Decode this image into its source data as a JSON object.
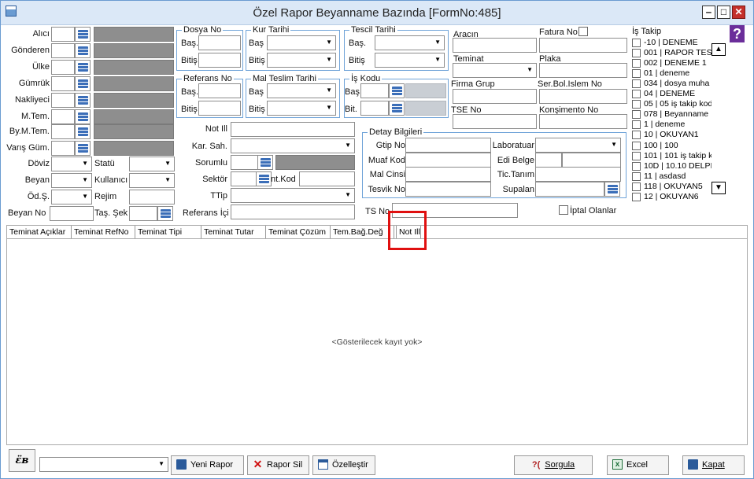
{
  "window": {
    "title": "Özel Rapor Beyanname Bazında [FormNo:485]",
    "help": "?"
  },
  "left": {
    "alici": "Alıcı",
    "gonderen": "Gönderen",
    "ulke": "Ülke",
    "gumruk": "Gümrük",
    "nakliyeci": "Nakliyeci",
    "mtem": "M.Tem.",
    "bymtem": "By.M.Tem.",
    "varis": "Varış Güm.",
    "doviz": "Döviz",
    "beyan": "Beyan",
    "ods": "Öd.Ş.",
    "beyanno": "Beyan No",
    "statu": "Statü",
    "kullanici": "Kullanıcı",
    "rejim": "Rejim",
    "tassek": "Taş. Şek"
  },
  "groups": {
    "dosya_no": "Dosya No",
    "kur_tarihi": "Kur Tarihi",
    "tescil_tarihi": "Tescil Tarihi",
    "referans_no": "Referans No",
    "mal_teslim": "Mal Teslim Tarihi",
    "is_kodu": "İş Kodu",
    "bas": "Baş.",
    "bitis": "Bitiş",
    "bit": "Bit.",
    "bas2": "Baş",
    "bitis2": "Bitiş"
  },
  "mid": {
    "not_ill": "Not Ill",
    "kar_sah": "Kar. Sah.",
    "sorumlu": "Sorumlu",
    "sektor": "Sektör",
    "int_kod": "nt.Kod",
    "ttip": "TTip",
    "referans_ici": "Referans İçi"
  },
  "right": {
    "aracin": "Aracın",
    "fatura_no": "Fatura No",
    "teminat": "Teminat",
    "plaka": "Plaka",
    "firma_grup": "Firma Grup",
    "ser_bol": "Ser.Bol.Islem No",
    "tse_no": "TSE No",
    "konsimento": "Konşimento No",
    "ts_no": "TS No",
    "iptal": "İptal Olanlar"
  },
  "detay": {
    "title": "Detay Bilgileri",
    "gtip": "Gtip No",
    "muaf": "Muaf Kod",
    "mal_cinsi": "Mal Cinsi",
    "tesvik": "Tesvik No",
    "lab": "Laboratuar",
    "edi": "Edi Belge",
    "tic": "Tic.Tanım",
    "supalan": "Supalan"
  },
  "is_takip": {
    "title": "İş Takip",
    "items": [
      "-10 | DENEME",
      "001 | RAPOR TES",
      "002 | DENEME 1",
      "01 | deneme",
      "034 | dosya muha",
      "04 | DENEME",
      "05 | 05 iş takip kod",
      "078 | Beyanname",
      "1 | deneme",
      "10 | OKUYAN1",
      "100 | 100",
      "101 | 101 iş takip k",
      "10D | 10.10 DELPI",
      "11 | asdasd",
      "118 | OKUYAN5",
      "12 | OKUYAN6"
    ]
  },
  "grid": {
    "columns": [
      "Teminat Açıklar",
      "Teminat RefNo",
      "Teminat Tipi",
      "Teminat Tutar",
      "Teminat Çözüm",
      "Tem.Bağ.Değ",
      "Not Ill"
    ],
    "empty": "<Gösterilecek kayıt yok>"
  },
  "buttons": {
    "logo": "ɛ̈ʙ",
    "yeni": "Yeni Rapor",
    "sil": "Rapor Sil",
    "ozel": "Özelleştir",
    "sorgula_pre": "?(",
    "sorgula": "Sorgula",
    "excel": "Excel",
    "kapat": "Kapat"
  },
  "colors": {
    "highlight": "#e01010",
    "group_border": "#6fa3d8"
  }
}
